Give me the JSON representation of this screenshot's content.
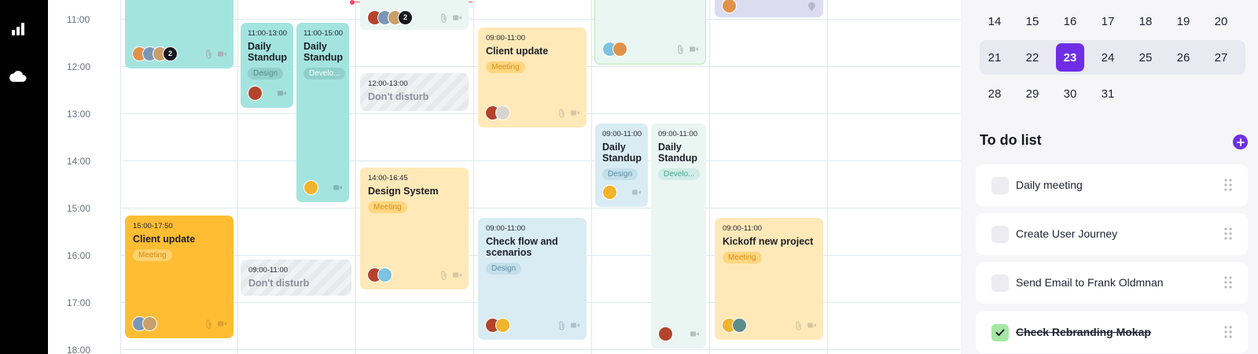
{
  "sidebar": {
    "icons": [
      "bar-chart-icon",
      "cloud-icon"
    ]
  },
  "calendar": {
    "hours": [
      "11:00",
      "12:00",
      "13:00",
      "14:00",
      "15:00",
      "16:00",
      "17:00",
      "18:00"
    ],
    "events": [
      {
        "time": "",
        "title": "",
        "tag": "",
        "count": "2"
      },
      {
        "time": "11:00-13:00",
        "title": "Daily Standup",
        "tag": "Design"
      },
      {
        "time": "11:00-15:00",
        "title": "Daily Standup",
        "tag": "Develo..."
      },
      {
        "time": "",
        "title": "",
        "tag": "",
        "count": "2"
      },
      {
        "time": "12:00-13:00",
        "title": "Don't disturb"
      },
      {
        "time": "14:00-16:45",
        "title": "Design System",
        "tag": "Meeting"
      },
      {
        "time": "09:00-11:00",
        "title": "Client update",
        "tag": "Meeting"
      },
      {
        "time": "09:00-11:00",
        "title": "Check flow and scenarios",
        "tag": "Design"
      },
      {
        "time": "09:00-11:00",
        "title": "Daily Standup",
        "tag": "Design"
      },
      {
        "time": "09:00-11:00",
        "title": "Daily Standup",
        "tag": "Develo..."
      },
      {
        "time": "15:00-17:50",
        "title": "Client update",
        "tag": "Meeting"
      },
      {
        "time": "09:00-11:00",
        "title": "Don't disturb"
      },
      {
        "time": "09:00-11:00",
        "title": "Kickoff new project",
        "tag": "Meeting"
      }
    ]
  },
  "mini_calendar": {
    "rows": [
      [
        "14",
        "15",
        "16",
        "17",
        "18",
        "19",
        "20"
      ],
      [
        "21",
        "22",
        "23",
        "24",
        "25",
        "26",
        "27"
      ],
      [
        "28",
        "29",
        "30",
        "31"
      ]
    ],
    "selected": "23"
  },
  "todo": {
    "title": "To do list",
    "items": [
      {
        "label": "Daily meeting",
        "done": false
      },
      {
        "label": "Create User Journey",
        "done": false
      },
      {
        "label": "Send Email to Frank Oldmnan",
        "done": false
      },
      {
        "label": "Check Rebranding Mokap",
        "done": true
      }
    ]
  },
  "colors": {
    "accent": "#6f2ee6",
    "teal": "#a4e4df",
    "amber": "#ffbd33",
    "light_yellow": "#ffe9b8",
    "light_blue": "#d9ecf3",
    "mint": "#eaf6f2",
    "lavender": "#dcdcf1",
    "check_green": "#a6e7a4"
  }
}
